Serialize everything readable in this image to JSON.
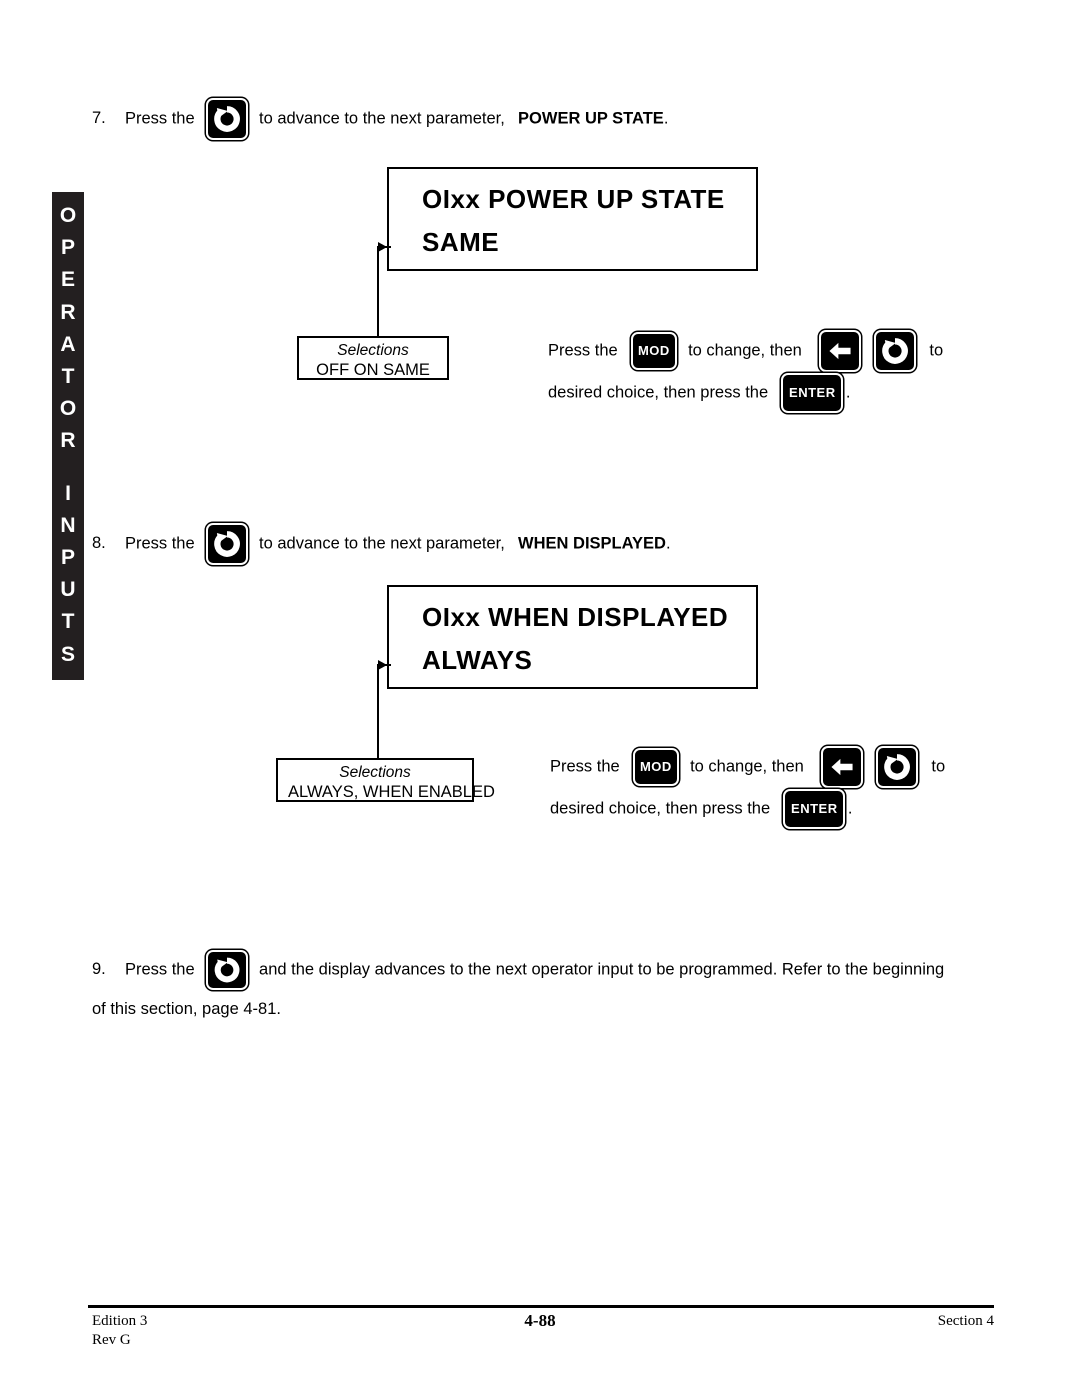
{
  "side_tab": {
    "line1": "OPERATOR",
    "line2": "INPUTS",
    "letters1": [
      "O",
      "P",
      "E",
      "R",
      "A",
      "T",
      "O",
      "R"
    ],
    "letters2": [
      "I",
      "N",
      "P",
      "U",
      "T",
      "S"
    ],
    "bg_color": "#231f20",
    "text_color": "#ffffff"
  },
  "steps": [
    {
      "number": "7.",
      "text_before_key": "Press the",
      "key": "round-arrow-key",
      "text_after_key": "to advance to the next parameter,",
      "bold_param": "POWER UP STATE",
      "period": "."
    },
    {
      "number": "8.",
      "text_before_key": "Press the",
      "key": "round-arrow-key",
      "text_after_key": "to advance to the next parameter,",
      "bold_param": "WHEN DISPLAYED",
      "period": "."
    },
    {
      "number": "9.",
      "text_before_key": "Press the",
      "key": "round-arrow-key",
      "text_after_key": "and the display advances to the next operator input to be programmed.  Refer to the beginning",
      "line2": "of this section, page 4-81."
    }
  ],
  "displays": [
    {
      "line1": "OIxx  POWER  UP  STATE",
      "line2": "SAME"
    },
    {
      "line1": "OIxx  WHEN  DISPLAYED",
      "line2": "ALWAYS"
    }
  ],
  "selections": [
    {
      "title": "Selections",
      "values": "OFF  ON  SAME"
    },
    {
      "title": "Selections",
      "values": "ALWAYS, WHEN ENABLED"
    }
  ],
  "instructions": [
    {
      "seg1": "Press the",
      "key1": "MOD",
      "seg2": "to change, then",
      "key2": "left-arrow-key",
      "key3": "round-arrow-key",
      "seg3": "to",
      "seg4": "desired choice, then press the",
      "key4": "ENTER",
      "seg5": "."
    },
    {
      "seg1": "Press the",
      "key1": "MOD",
      "seg2": "to change, then",
      "key2": "left-arrow-key",
      "key3": "round-arrow-key",
      "seg3": "to",
      "seg4": "desired choice, then press the",
      "key4": "ENTER",
      "seg5": "."
    }
  ],
  "keys": {
    "mod_label": "MOD",
    "enter_label": "ENTER"
  },
  "footer": {
    "edition": "Edition 3",
    "rev": "Rev G",
    "page": "4-88",
    "section": "Section 4"
  }
}
